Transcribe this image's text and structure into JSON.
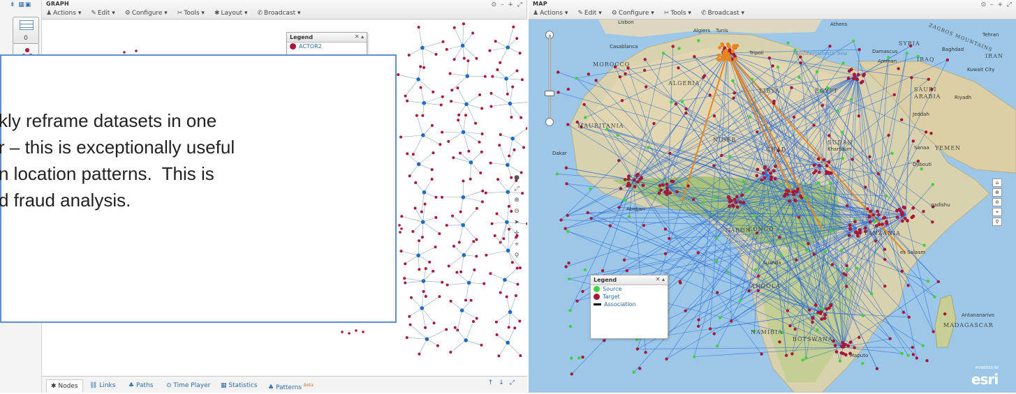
{
  "rail": {
    "count_label": "0"
  },
  "graph": {
    "title": "GRAPH",
    "window_controls": [
      "⊙",
      "–",
      "+",
      "⤢"
    ],
    "menu": [
      {
        "icon": "user-icon",
        "glyph": "♟",
        "label": "Actions"
      },
      {
        "icon": "pencil-icon",
        "glyph": "✎",
        "label": "Edit"
      },
      {
        "icon": "gears-icon",
        "glyph": "⚙",
        "label": "Configure"
      },
      {
        "icon": "wrench-icon",
        "glyph": "✂",
        "label": "Tools"
      },
      {
        "icon": "asterisk-icon",
        "glyph": "✱",
        "label": "Layout"
      },
      {
        "icon": "broadcast-icon",
        "glyph": "✆",
        "label": "Broadcast"
      }
    ],
    "legend": {
      "title": "Legend",
      "items": [
        {
          "label": "ACTOR2",
          "color": "#a8173a"
        }
      ]
    },
    "tabs": [
      {
        "label": "Nodes",
        "glyph": "✱",
        "active": true
      },
      {
        "label": "Links",
        "glyph": "⛓"
      },
      {
        "label": "Paths",
        "glyph": "♣"
      },
      {
        "label": "Time Player",
        "glyph": "⊙"
      },
      {
        "label": "Statistics",
        "glyph": "▦"
      },
      {
        "label": "Patterns",
        "glyph": "♣",
        "badge": "Beta"
      }
    ]
  },
  "callout": {
    "lines": [
      "kly reframe datasets in one",
      "r – this is exceptionally useful",
      "n location patterns.  This is",
      "d fraud analysis."
    ]
  },
  "map": {
    "title": "MAP",
    "window_controls": [
      "⊙",
      "–",
      "+",
      "⤢"
    ],
    "menu": [
      {
        "icon": "user-icon",
        "glyph": "♟",
        "label": "Actions"
      },
      {
        "icon": "pencil-icon",
        "glyph": "✎",
        "label": "Edit"
      },
      {
        "icon": "gears-icon",
        "glyph": "⚙",
        "label": "Configure"
      },
      {
        "icon": "wrench-icon",
        "glyph": "✂",
        "label": "Tools"
      },
      {
        "icon": "broadcast-icon",
        "glyph": "✆",
        "label": "Broadcast"
      }
    ],
    "legend": {
      "title": "Legend",
      "items": [
        {
          "label": "Source",
          "color": "#3fd13f",
          "kind": "dot"
        },
        {
          "label": "Target",
          "color": "#a8173a",
          "kind": "dot"
        },
        {
          "label": "Association",
          "color": "#000000",
          "kind": "line"
        }
      ]
    },
    "places": {
      "lisbon": "Lisbon",
      "algiers": "Algiers",
      "tunis": "Tunis",
      "athens": "Athens",
      "tehran": "Tehran",
      "syria": "SYRIA",
      "baghdad": "Baghdad",
      "iran": "IRAN",
      "damascus": "Damascus",
      "amman": "Amman",
      "iraq": "IRAQ",
      "kuwait": "Kuwait City",
      "casablanca": "Casablanca",
      "tripoli": "Tripoli",
      "mediterranean": "Mediterranean Sea",
      "morocco": "MOROCCO",
      "algeria": "ALGERIA",
      "libya": "LIBYA",
      "egypt": "EGYPT",
      "saudi": "SAUDI",
      "arabia": "ARABIA",
      "riyadh": "Riyadh",
      "jeddah": "Jeddah",
      "mauritania": "MAURITANIA",
      "niger": "NIGER",
      "chad": "CHAD",
      "sudan": "SUDAN",
      "khartoum": "Khartoum",
      "dakar": "Dakar",
      "sanaa": "Sanaa",
      "yemen": "YEMEN",
      "djibouti": "Djibouti",
      "abidjan": "Abidjan",
      "mogadishu": "gadishu",
      "gabon": "GABON",
      "congo": "CONGO",
      "tanzania": "TANZANIA",
      "dar": "es Salaam",
      "luanda": "Luanda",
      "angola": "ANGOLA",
      "madagascar": "MADAGASCAR",
      "antananarivo": "Antananarivo",
      "namibia": "NAMIBIA",
      "botswana": "BOTSWANA",
      "maputo": "Maputo",
      "zagros": "ZAGROS MOUNTAINS"
    },
    "attribution": "esri",
    "attribution_small": "POWERED BY"
  },
  "colors": {
    "target": "#a8173a",
    "source": "#3fd13f",
    "node_blue": "#1f6bc4",
    "edge_blue": "#2a6ad6",
    "edge_orange": "#e8861d"
  }
}
